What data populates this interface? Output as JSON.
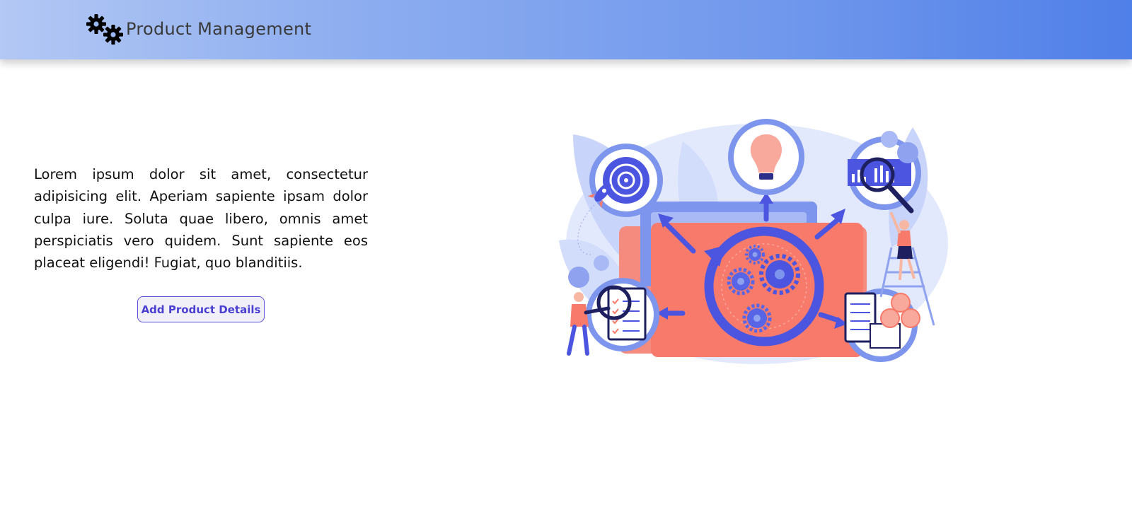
{
  "navbar": {
    "title": "Product Management",
    "icon": "gears-icon"
  },
  "main": {
    "intro_text": "Lorem ipsum dolor sit amet, consectetur adipisicing elit. Aperiam sapiente ipsam dolor culpa iure. Soluta quae libero, omnis amet perspiciatis vero quidem. Sunt sapiente eos placeat eligendi! Fugiat, quo blanditiis.",
    "add_button_label": "Add Product Details",
    "illustration": "product-management-illustration"
  },
  "colors": {
    "nav_gradient_start": "#b3c8f4",
    "nav_gradient_end": "#4f7fe8",
    "button_accent": "#4a3fd1",
    "illustration_blue": "#4b55e0",
    "illustration_coral": "#f47c6e"
  }
}
